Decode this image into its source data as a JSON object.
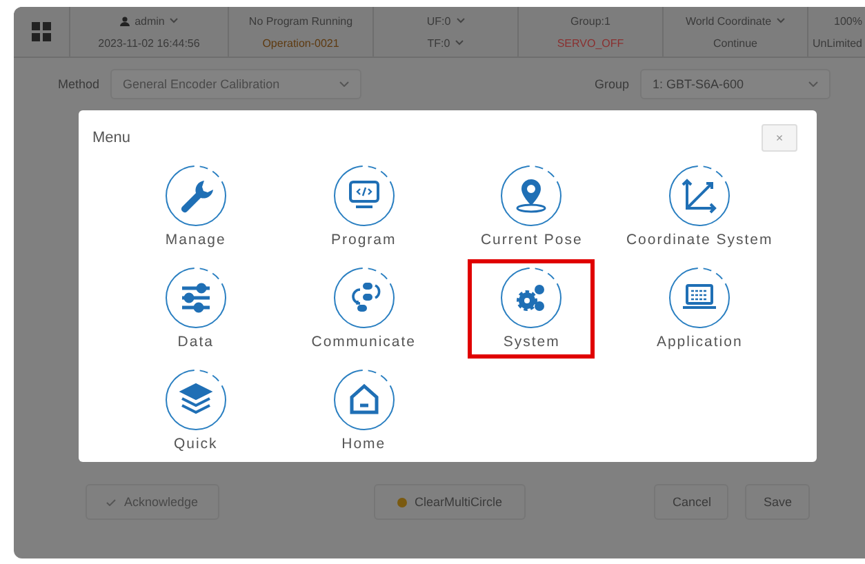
{
  "status_bar": {
    "user": "admin",
    "datetime": "2023-11-02 16:44:56",
    "program": "No Program Running",
    "operation": "Operation-0021",
    "uf": "UF:0",
    "tf": "TF:0",
    "group": "Group:1",
    "servo": "SERVO_OFF",
    "coordinate": "World Coordinate",
    "mode": "Continue",
    "speed": "100%",
    "limit": "UnLimited"
  },
  "form": {
    "method_label": "Method",
    "method_value": "General Encoder Calibration",
    "group_label": "Group",
    "group_value": "1: GBT-S6A-600"
  },
  "menu": {
    "title": "Menu",
    "close": "×",
    "items": [
      {
        "label": "Manage",
        "highlighted": false
      },
      {
        "label": "Program",
        "highlighted": false
      },
      {
        "label": "Current Pose",
        "highlighted": false
      },
      {
        "label": "Coordinate System",
        "highlighted": false
      },
      {
        "label": "Data",
        "highlighted": false
      },
      {
        "label": "Communicate",
        "highlighted": false
      },
      {
        "label": "System",
        "highlighted": true
      },
      {
        "label": "Application",
        "highlighted": false
      },
      {
        "label": "Quick",
        "highlighted": false
      },
      {
        "label": "Home",
        "highlighted": false
      }
    ]
  },
  "footer": {
    "acknowledge": "Acknowledge",
    "clear": "ClearMultiCircle",
    "cancel": "Cancel",
    "save": "Save"
  }
}
